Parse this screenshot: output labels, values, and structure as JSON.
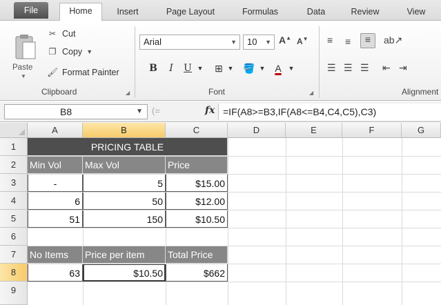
{
  "tabs": [
    "File",
    "Home",
    "Insert",
    "Page Layout",
    "Formulas",
    "Data",
    "Review",
    "View"
  ],
  "clipboard": {
    "paste_label": "Paste",
    "cut_label": "Cut",
    "copy_label": "Copy",
    "format_painter_label": "Format Painter",
    "group_label": "Clipboard"
  },
  "font": {
    "name": "Arial",
    "size": "10",
    "group_label": "Font"
  },
  "alignment": {
    "group_label": "Alignment"
  },
  "formula_bar": {
    "name_box": "B8",
    "fx": "fx",
    "formula": "=IF(A8>=B3,IF(A8<=B4,C4,C5),C3)"
  },
  "columns": [
    "A",
    "B",
    "C",
    "D",
    "E",
    "F",
    "G"
  ],
  "rows": [
    "1",
    "2",
    "3",
    "4",
    "5",
    "6",
    "7",
    "8",
    "9"
  ],
  "sheet": {
    "title": "PRICING TABLE",
    "headers": [
      "Min Vol",
      "Max Vol",
      "Price"
    ],
    "data": [
      [
        "-",
        "5",
        "$15.00"
      ],
      [
        "6",
        "50",
        "$12.00"
      ],
      [
        "51",
        "150",
        "$10.50"
      ]
    ],
    "calc_headers": [
      "No Items",
      "Price per item",
      "Total Price"
    ],
    "calc_values": [
      "63",
      "$10.50",
      "$662"
    ]
  },
  "colors": {
    "title_fill": "#4e4e4e",
    "header_fill": "#878787",
    "selection": "#f7cb6a"
  }
}
